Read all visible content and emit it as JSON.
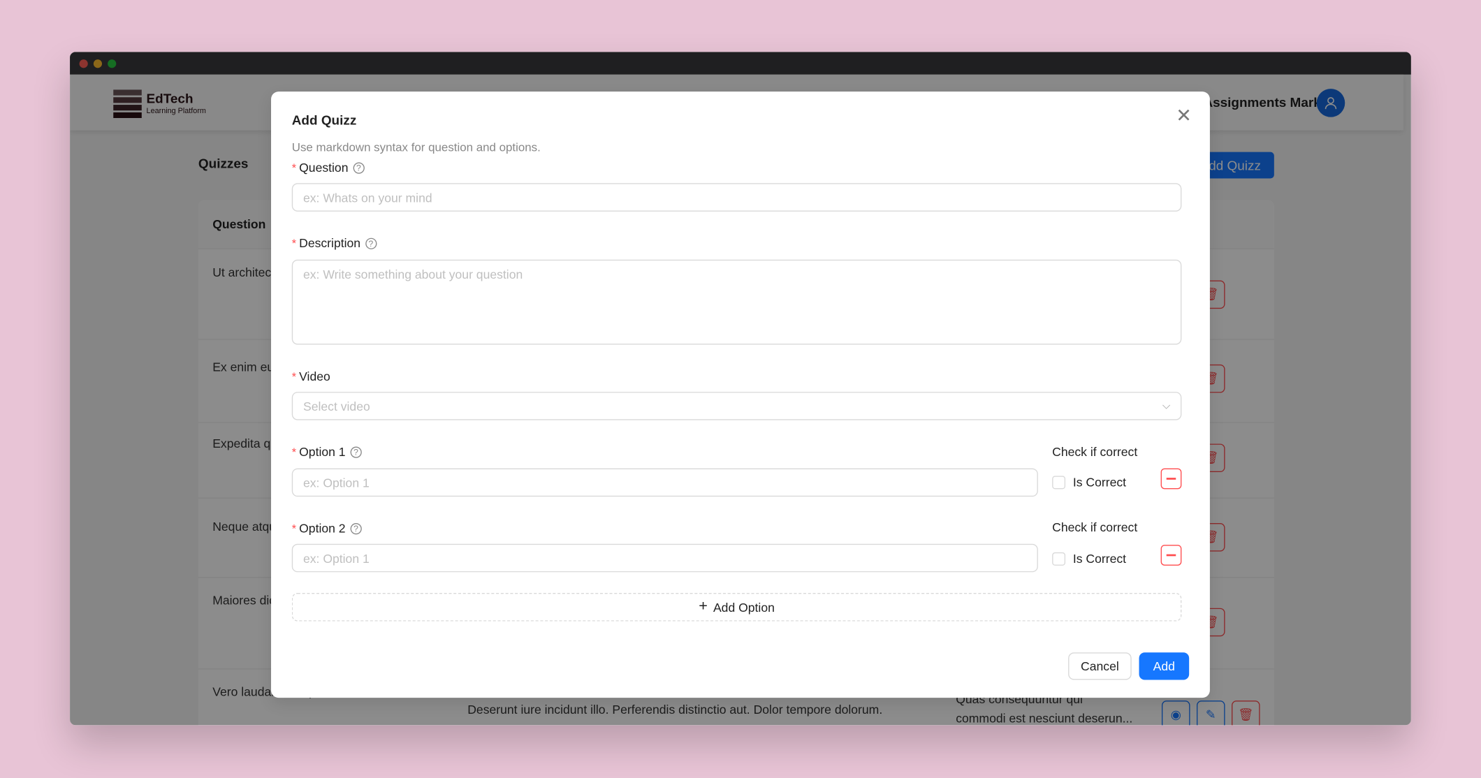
{
  "window": {
    "controls": [
      "close",
      "minimize",
      "maximize"
    ]
  },
  "header": {
    "brand": "EdTech",
    "brand_sub": "Learning Platform",
    "nav_partial": "Assignments Mark",
    "avatar_icon": "user-icon"
  },
  "page": {
    "title": "Quizzes",
    "add_button": "Add Quizz"
  },
  "table": {
    "header_question": "Question",
    "rows": [
      {
        "question": "Ut architecto nulla.",
        "description": "",
        "answer": ""
      },
      {
        "question": "Ex enim eu",
        "description": "",
        "answer": ""
      },
      {
        "question": "Expedita quo exercitationem",
        "description": "",
        "answer": ""
      },
      {
        "question": "Neque atque",
        "description": "",
        "answer": ""
      },
      {
        "question": "Maiores dicta deleniti saepe",
        "description": "",
        "answer": ""
      },
      {
        "question": "Vero laudantium quaerat.",
        "description": "Deserunt iure incidunt illo. Perferendis distinctio aut. Dolor tempore dolorum.",
        "answer": "Quas consequuntur qui commodi est nesciunt deserun..."
      }
    ]
  },
  "modal": {
    "title": "Add Quizz",
    "hint": "Use markdown syntax for question and options.",
    "question": {
      "label": "Question",
      "placeholder": "ex: Whats on your mind",
      "value": ""
    },
    "description": {
      "label": "Description",
      "placeholder": "ex: Write something about your question",
      "value": ""
    },
    "video": {
      "label": "Video",
      "placeholder": "Select video"
    },
    "options": [
      {
        "label": "Option 1",
        "placeholder": "ex: Option 1",
        "check_label": "Check if correct",
        "checkbox_label": "Is Correct",
        "checked": false
      },
      {
        "label": "Option 2",
        "placeholder": "ex: Option 1",
        "check_label": "Check if correct",
        "checkbox_label": "Is Correct",
        "checked": false
      }
    ],
    "add_option": "Add Option",
    "cancel": "Cancel",
    "submit": "Add"
  },
  "colors": {
    "primary": "#1677ff",
    "danger": "#ff4d4f",
    "background": "#e8c4d6"
  }
}
